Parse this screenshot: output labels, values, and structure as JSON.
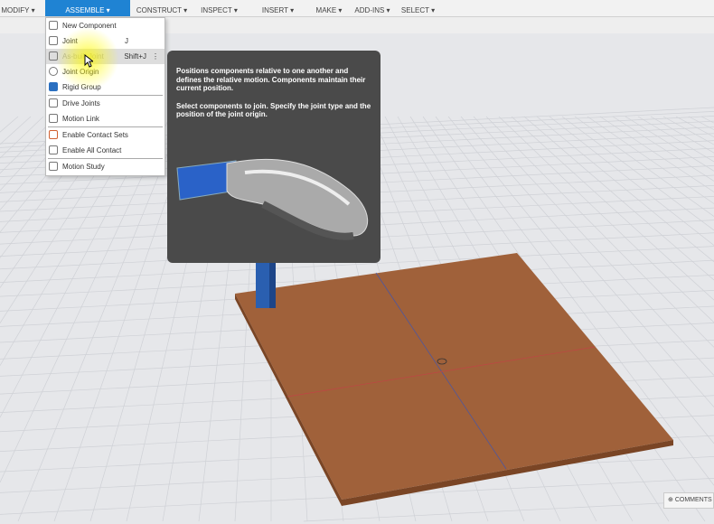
{
  "toolbar": {
    "tabs": [
      {
        "label": "MODIFY ▾"
      },
      {
        "label": "ASSEMBLE ▾",
        "active": true
      },
      {
        "label": "CONSTRUCT ▾"
      },
      {
        "label": "INSPECT ▾"
      },
      {
        "label": "INSERT ▾"
      },
      {
        "label": "MAKE ▾"
      },
      {
        "label": "ADD-INS ▾"
      },
      {
        "label": "SELECT ▾"
      }
    ]
  },
  "menu": {
    "items": [
      {
        "label": "New Component",
        "icon": "new-component-icon"
      },
      {
        "label": "Joint",
        "shortcut": "J",
        "icon": "joint-icon"
      },
      {
        "label": "As-built Joint",
        "shortcut": "Shift+J",
        "icon": "as-built-joint-icon"
      },
      {
        "label": "Joint Origin",
        "icon": "joint-origin-icon"
      },
      {
        "label": "Rigid Group",
        "icon": "rigid-group-icon"
      },
      {
        "label": "Drive Joints",
        "icon": "drive-joints-icon"
      },
      {
        "label": "Motion Link",
        "icon": "motion-link-icon"
      },
      {
        "label": "Enable Contact Sets",
        "icon": "contact-sets-icon"
      },
      {
        "label": "Enable All Contact",
        "icon": "all-contact-icon"
      },
      {
        "label": "Motion Study",
        "icon": "motion-study-icon"
      }
    ]
  },
  "tooltip": {
    "p1": "Positions components relative to one another and defines the relative motion. Components maintain their current position.",
    "p2": "Select components to join. Specify the joint type and the position of the joint origin."
  },
  "comments": {
    "label": "COMMENTS"
  },
  "colors": {
    "accent": "#1f83d3",
    "plate": "#a0613a",
    "column": "#2a5fb0"
  }
}
